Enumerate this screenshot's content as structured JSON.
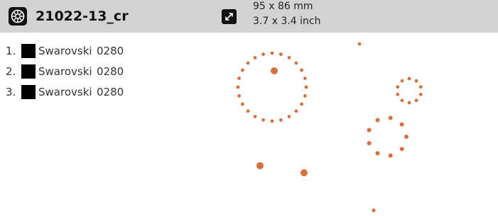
{
  "header": {
    "design_icon": "design-wheel-icon",
    "design_name": "21022-13_cr",
    "resize_icon": "resize-arrows-icon",
    "size_mm": "95 x 86 mm",
    "size_inch": "3.7 x 3.4 inch"
  },
  "colors": [
    {
      "number": "1.",
      "brand": "Swarovski",
      "code": "0280",
      "swatch": "#000000"
    },
    {
      "number": "2.",
      "brand": "Swarovski",
      "code": "0280",
      "swatch": "#000000"
    },
    {
      "number": "3.",
      "brand": "Swarovski",
      "code": "0280",
      "swatch": "#000000"
    }
  ],
  "preview": {
    "stone_color": "#d9703c"
  }
}
